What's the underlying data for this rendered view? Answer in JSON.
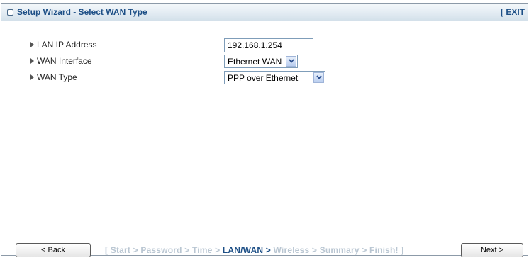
{
  "header": {
    "title": "Setup Wizard - Select WAN Type",
    "exit_label": "[ EXIT"
  },
  "fields": [
    {
      "label": "LAN IP Address",
      "type": "text",
      "value": "192.168.1.254"
    },
    {
      "label": "WAN Interface",
      "type": "select",
      "value": "Ethernet WAN"
    },
    {
      "label": "WAN Type",
      "type": "select",
      "value": "PPP over Ethernet"
    }
  ],
  "footer": {
    "back_label": "< Back",
    "next_label": "Next >",
    "steps": {
      "open": "[ ",
      "start": "Start",
      "password": "Password",
      "time": "Time",
      "lan_wan": "LAN/WAN",
      "wireless": "Wireless",
      "summary": "Summary",
      "finish": "Finish!",
      "close": " ]",
      "separator": " > "
    },
    "active_step": "LAN/WAN"
  },
  "colors": {
    "title": "#1d4f86",
    "inactive_step": "#b9c6d2",
    "header_bg": "#e3ecf3"
  }
}
